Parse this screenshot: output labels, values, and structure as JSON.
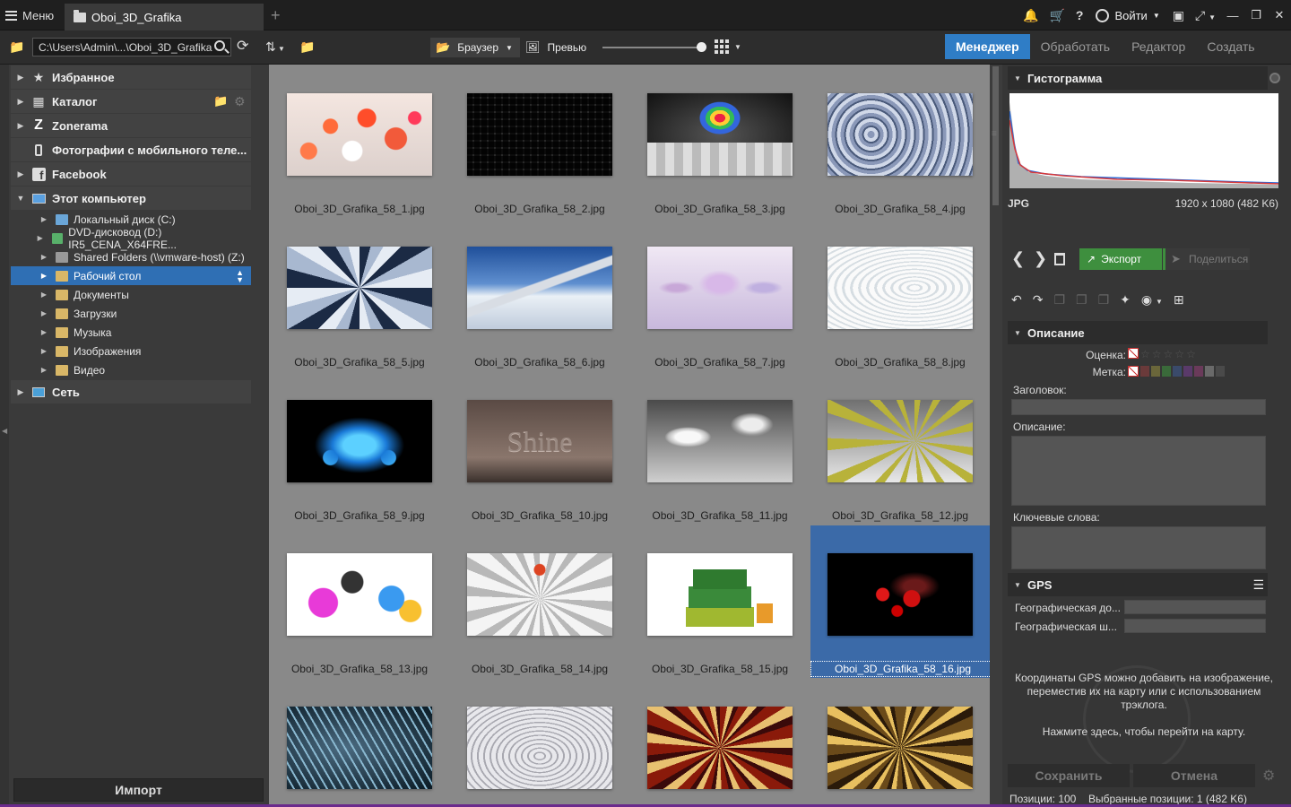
{
  "titlebar": {
    "menu_label": "Меню",
    "tab_title": "Oboi_3D_Grafika",
    "login_label": "Войти"
  },
  "toolbar": {
    "path": "C:\\Users\\Admin\\...\\Oboi_3D_Grafika",
    "browser_label": "Браузер",
    "preview_label": "Превью",
    "modes": [
      "Менеджер",
      "Обработать",
      "Редактор",
      "Создать"
    ],
    "active_mode": "Менеджер"
  },
  "sidebar": {
    "favorites": "Избранное",
    "catalog": "Каталог",
    "zonerama": "Zonerama",
    "mobile": "Фотографии с мобильного теле...",
    "facebook": "Facebook",
    "this_pc": "Этот компьютер",
    "drives": [
      "Локальный диск (C:)",
      "DVD-дисковод (D:) IR5_CENA_X64FRE...",
      "Shared Folders (\\\\vmware-host) (Z:)",
      "Рабочий стол",
      "Документы",
      "Загрузки",
      "Музыка",
      "Изображения",
      "Видео"
    ],
    "network": "Сеть",
    "import_label": "Импорт"
  },
  "files": [
    "Oboi_3D_Grafika_58_1.jpg",
    "Oboi_3D_Grafika_58_2.jpg",
    "Oboi_3D_Grafika_58_3.jpg",
    "Oboi_3D_Grafika_58_4.jpg",
    "Oboi_3D_Grafika_58_5.jpg",
    "Oboi_3D_Grafika_58_6.jpg",
    "Oboi_3D_Grafika_58_7.jpg",
    "Oboi_3D_Grafika_58_8.jpg",
    "Oboi_3D_Grafika_58_9.jpg",
    "Oboi_3D_Grafika_58_10.jpg",
    "Oboi_3D_Grafika_58_11.jpg",
    "Oboi_3D_Grafika_58_12.jpg",
    "Oboi_3D_Grafika_58_13.jpg",
    "Oboi_3D_Grafika_58_14.jpg",
    "Oboi_3D_Grafika_58_15.jpg",
    "Oboi_3D_Grafika_58_16.jpg"
  ],
  "thumb_text_10": "Shine",
  "right_panel": {
    "histogram_title": "Гистограмма",
    "format": "JPG",
    "dimensions": "1920 x 1080 (482 K6)",
    "export_label": "Экспорт",
    "share_label": "Поделиться",
    "description_title": "Описание",
    "rating_label": "Оценка:",
    "label_label": "Метка:",
    "title_label": "Заголовок:",
    "desc_label": "Описание:",
    "keywords_label": "Ключевые слова:",
    "gps_title": "GPS",
    "geo_lat": "Географическая до...",
    "geo_lon": "Географическая ш...",
    "gps_info": "Координаты GPS можно добавить на изображение, переместив их на карту или с использованием трэклога.",
    "gps_click": "Нажмите здесь, чтобы перейти на карту.",
    "save_label": "Сохранить",
    "cancel_label": "Отмена"
  },
  "status": {
    "positions": "Позиции: 100",
    "selected": "Выбранные позиции: 1 (482 K6)"
  },
  "colors": {
    "accent": "#2f7dc6",
    "export_green": "#3e8f3e",
    "selection": "#3b6aa8"
  }
}
